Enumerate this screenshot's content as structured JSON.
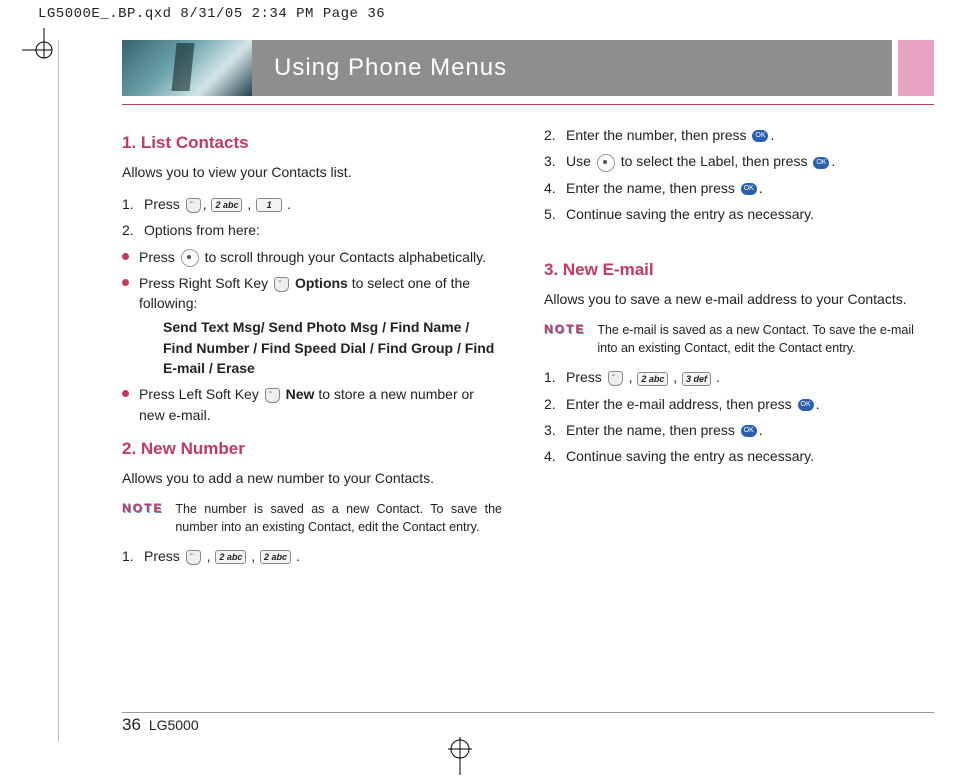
{
  "meta": {
    "filepath_line": "LG5000E_.BP.qxd  8/31/05  2:34 PM  Page 36"
  },
  "header": {
    "title": "Using Phone Menus"
  },
  "left": {
    "sec1_title": "1. List Contacts",
    "sec1_intro": "Allows you to view your Contacts list.",
    "sec1_step1_pre": "Press ",
    "sec1_step1_k1": "2 abc",
    "sec1_step1_k2": "1",
    "sec1_step2": "Options from here:",
    "sec1_b1_a": "Press ",
    "sec1_b1_b": " to scroll through your Contacts alphabetically.",
    "sec1_b2_a": "Press Right Soft Key ",
    "sec1_b2_opt": "Options",
    "sec1_b2_b": " to select one of the following:",
    "sec1_b2_list": "Send Text Msg/ Send Photo Msg / Find Name / Find Number / Find Speed Dial / Find Group / Find E-mail / Erase",
    "sec1_b3_a": "Press Left Soft Key ",
    "sec1_b3_new": "New",
    "sec1_b3_b": " to store a new number or new e-mail.",
    "sec2_title": "2. New Number",
    "sec2_intro": "Allows you to add a new number to your Contacts.",
    "sec2_note": "The number is saved as a new Contact. To save the number into an existing Contact, edit the Contact entry.",
    "sec2_step1_pre": "Press ",
    "sec2_step1_k1": "2 abc",
    "sec2_step1_k2": "2 abc"
  },
  "right": {
    "s2_2a": "Enter the number, then press ",
    "s2_3a": "Use ",
    "s2_3b": " to select the Label, then press ",
    "s2_4a": "Enter the name, then press ",
    "s2_5": "Continue saving the entry as necessary.",
    "sec3_title": "3. New E-mail",
    "sec3_intro": "Allows you to save a new e-mail address to your Contacts.",
    "sec3_note": "The e-mail is saved as a new Contact. To save the e-mail into an existing Contact, edit the Contact entry.",
    "s3_1_pre": "Press ",
    "s3_1_k1": "2 abc",
    "s3_1_k2": "3 def",
    "s3_2a": "Enter the e-mail address, then press ",
    "s3_3a": "Enter the name, then press ",
    "s3_4": "Continue saving the entry as necessary."
  },
  "labels": {
    "note": "NOTE",
    "ok": "OK"
  },
  "footer": {
    "page": "36",
    "model": "LG5000"
  }
}
